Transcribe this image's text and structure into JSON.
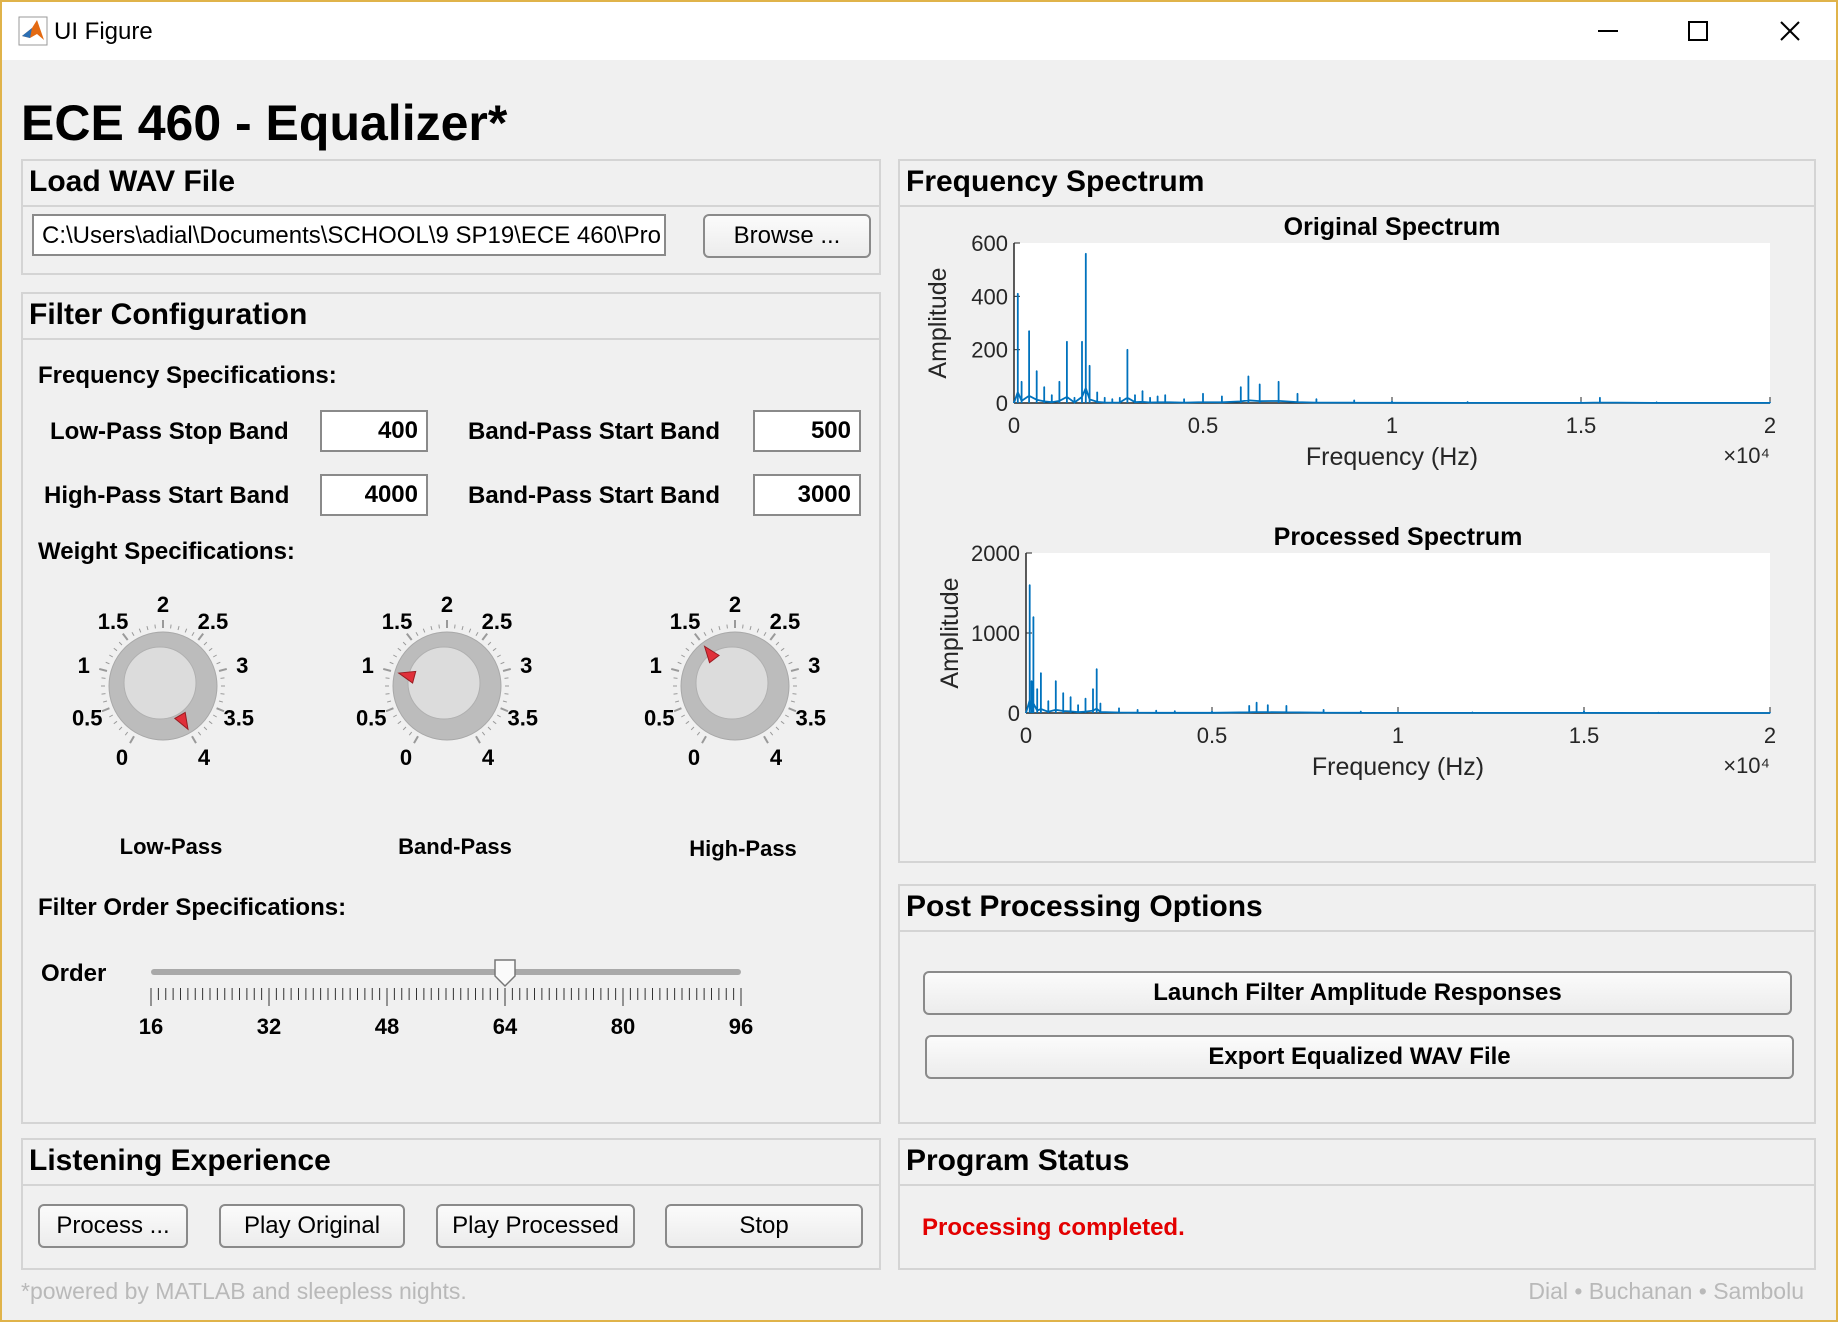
{
  "window": {
    "title": "UI Figure"
  },
  "app": {
    "title": "ECE 460 - Equalizer*",
    "footer_left": "*powered by MATLAB and sleepless nights.",
    "footer_right": "Dial • Buchanan • Sambolu"
  },
  "load_wav": {
    "title": "Load WAV File",
    "file_path": "C:\\Users\\adial\\Documents\\SCHOOL\\9 SP19\\ECE 460\\Pro",
    "browse_label": "Browse ..."
  },
  "filter_config": {
    "title": "Filter Configuration",
    "freq_spec_label": "Frequency Specifications:",
    "fields": [
      {
        "label": "Low-Pass Stop Band",
        "value": "400"
      },
      {
        "label": "Band-Pass Start Band",
        "value": "500"
      },
      {
        "label": "High-Pass Start Band",
        "value": "4000"
      },
      {
        "label": "Band-Pass Start Band",
        "value": "3000"
      }
    ],
    "weight_spec_label": "Weight Specifications:",
    "knob_ticks": [
      "0",
      "0.5",
      "1",
      "1.5",
      "2",
      "2.5",
      "3",
      "3.5",
      "4"
    ],
    "knobs": [
      {
        "label": "Low-Pass",
        "value": 4.0
      },
      {
        "label": "Band-Pass",
        "value": 1.0
      },
      {
        "label": "High-Pass",
        "value": 1.5
      }
    ],
    "order_spec_label": "Filter Order Specifications:",
    "order_label": "Order",
    "order_ticks": [
      "16",
      "32",
      "48",
      "64",
      "80",
      "96"
    ],
    "order_min": 16,
    "order_max": 96,
    "order_value": 64
  },
  "spectrum": {
    "title": "Frequency Spectrum",
    "chart_data": [
      {
        "type": "line",
        "title": "Original Spectrum",
        "xlabel": "Frequency (Hz)",
        "ylabel": "Amplitude",
        "x_exponent": "×10⁴",
        "xlim": [
          0,
          2
        ],
        "ylim": [
          0,
          600
        ],
        "xticks": [
          "0",
          "0.5",
          "1",
          "1.5",
          "2"
        ],
        "yticks": [
          "0",
          "200",
          "400",
          "600"
        ],
        "color": "#0072bd",
        "series": [
          {
            "x": [
              0.0,
              0.01,
              0.02,
              0.04,
              0.06,
              0.08,
              0.1,
              0.12,
              0.14,
              0.16,
              0.18,
              0.19,
              0.2,
              0.22,
              0.24,
              0.26,
              0.28,
              0.3,
              0.32,
              0.34,
              0.36,
              0.38,
              0.4,
              0.45,
              0.5,
              0.55,
              0.6,
              0.62,
              0.65,
              0.7,
              0.75,
              0.8,
              0.9,
              1.0,
              1.2,
              1.5,
              1.55,
              1.7,
              2.0
            ],
            "values": [
              5,
              410,
              80,
              270,
              120,
              60,
              30,
              80,
              230,
              20,
              230,
              560,
              140,
              40,
              20,
              15,
              20,
              200,
              30,
              45,
              20,
              25,
              30,
              15,
              35,
              25,
              60,
              100,
              70,
              80,
              35,
              15,
              10,
              6,
              4,
              3,
              20,
              3,
              2
            ]
          }
        ]
      },
      {
        "type": "line",
        "title": "Processed Spectrum",
        "xlabel": "Frequency (Hz)",
        "ylabel": "Amplitude",
        "x_exponent": "×10⁴",
        "xlim": [
          0,
          2
        ],
        "ylim": [
          0,
          2000
        ],
        "xticks": [
          "0",
          "0.5",
          "1",
          "1.5",
          "2"
        ],
        "yticks": [
          "0",
          "1000",
          "2000"
        ],
        "color": "#0072bd",
        "series": [
          {
            "x": [
              0.0,
              0.01,
              0.015,
              0.02,
              0.03,
              0.04,
              0.06,
              0.08,
              0.1,
              0.12,
              0.14,
              0.16,
              0.18,
              0.19,
              0.2,
              0.25,
              0.3,
              0.35,
              0.4,
              0.5,
              0.6,
              0.62,
              0.65,
              0.7,
              0.8,
              0.9,
              1.0,
              1.2,
              1.5,
              1.7,
              2.0
            ],
            "values": [
              10,
              1600,
              400,
              1200,
              300,
              500,
              150,
              400,
              250,
              200,
              100,
              180,
              300,
              550,
              120,
              60,
              40,
              30,
              25,
              20,
              90,
              130,
              100,
              90,
              40,
              20,
              12,
              8,
              25,
              6,
              4
            ]
          }
        ]
      }
    ]
  },
  "post_processing": {
    "title": "Post Processing Options",
    "launch_label": "Launch Filter Amplitude Responses",
    "export_label": "Export Equalized WAV File"
  },
  "listening": {
    "title": "Listening Experience",
    "process_label": "Process ...",
    "play_original_label": "Play Original",
    "play_processed_label": "Play Processed",
    "stop_label": "Stop"
  },
  "status": {
    "title": "Program Status",
    "message": "Processing completed.",
    "message_color": "#e30000"
  }
}
